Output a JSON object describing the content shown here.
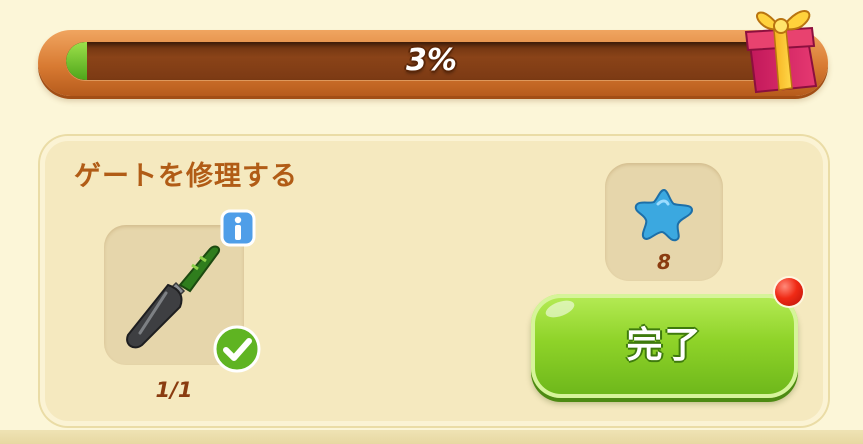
{
  "progress": {
    "percent_label": "3%",
    "fraction": 0.03,
    "fill_color": "#5cb82a"
  },
  "reward_icon": "gift-box-icon",
  "task": {
    "title": "ゲートを修理する",
    "item": {
      "icon": "garden-trowel-icon",
      "count": "1/1",
      "completed": true,
      "has_info": true
    },
    "reward": {
      "icon": "blue-star-icon",
      "amount": "8"
    },
    "complete_button": {
      "label": "完了",
      "notification": true
    }
  },
  "colors": {
    "title": "#b15c16",
    "button": "#8fd329",
    "notification": "#f02a15"
  }
}
